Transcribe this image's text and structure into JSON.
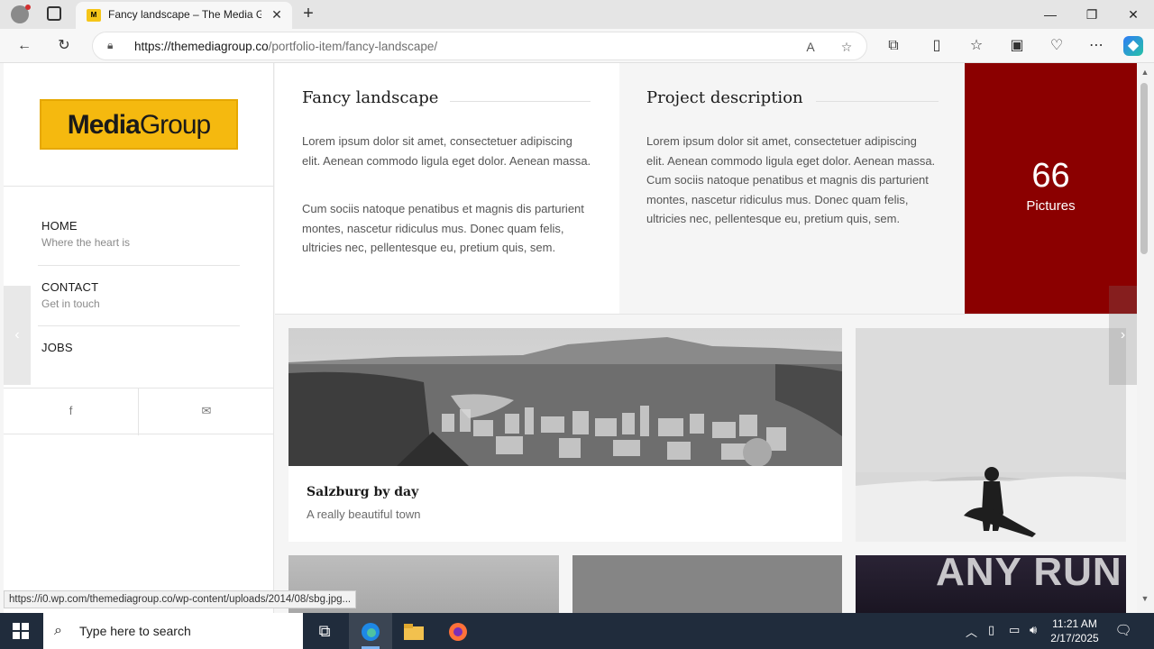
{
  "browser": {
    "tab_title": "Fancy landscape – The Media Gro",
    "tab_favicon_text": "M",
    "url_host": "https://themediagroup.co",
    "url_path": "/portfolio-item/fancy-landscape/",
    "status_url": "https://i0.wp.com/themediagroup.co/wp-content/uploads/2014/08/sbg.jpg..."
  },
  "sidebar": {
    "logo_bold": "Media",
    "logo_light": "Group",
    "nav": [
      {
        "title": "HOME",
        "sub": "Where the heart is"
      },
      {
        "title": "CONTACT",
        "sub": "Get in touch"
      },
      {
        "title": "JOBS",
        "sub": ""
      }
    ],
    "social": [
      "f",
      "✉"
    ]
  },
  "project": {
    "title": "Fancy landscape",
    "para1": "Lorem ipsum dolor sit amet, consectetuer adipiscing elit. Aenean commodo ligula eget dolor. Aenean massa.",
    "para2": "Cum sociis natoque penatibus et magnis dis parturient montes, nascetur ridiculus mus. Donec quam felis, ultricies nec, pellentesque eu, pretium quis, sem.",
    "desc_title": "Project description",
    "desc_para": "Lorem ipsum dolor sit amet, consectetuer adipiscing elit. Aenean commodo ligula eget dolor. Aenean massa. Cum sociis natoque penatibus et magnis dis parturient montes, nascetur ridiculus mus. Donec quam felis, ultricies nec, pellentesque eu, pretium quis, sem.",
    "count_number": "66",
    "count_label": "Pictures",
    "accent_color": "#8b0000"
  },
  "gallery": {
    "card_title": "Salzburg by day",
    "card_sub": "A really beautiful town",
    "watermark": "ANY RUN"
  },
  "taskbar": {
    "search_placeholder": "Type here to search",
    "time": "11:21 AM",
    "date": "2/17/2025"
  }
}
